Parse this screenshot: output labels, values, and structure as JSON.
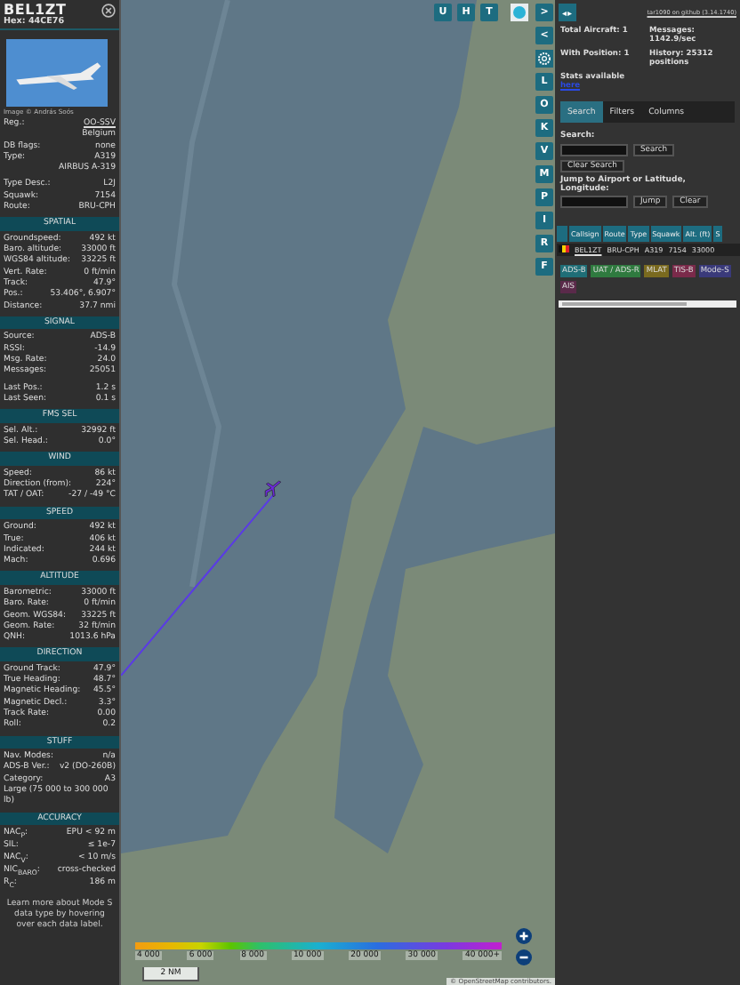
{
  "aircraft": {
    "callsign": "BEL1ZT",
    "hex_label": "Hex:",
    "hex": "44CE76",
    "photo_credit": "Image © András Soós",
    "info_groups": [
      [
        {
          "label": "Reg.:",
          "value": "OO-SSV",
          "link": true
        },
        {
          "value": "Belgium"
        },
        {
          "label": "DB flags:",
          "value": "none"
        },
        {
          "label": "Type:",
          "value": "A319"
        },
        {
          "value": "AIRBUS A-319"
        }
      ],
      [
        {
          "label": "Type Desc.:",
          "value": "L2J"
        },
        {
          "label": "Squawk:",
          "value": "7154"
        },
        {
          "label": "Route:",
          "value": "BRU-CPH"
        }
      ]
    ],
    "sections": [
      {
        "title": "SPATIAL",
        "groups": [
          [
            {
              "label": "Groundspeed:",
              "value": "492 kt"
            },
            {
              "label": "Baro. altitude:",
              "value": "33000 ft"
            },
            {
              "label": "WGS84 altitude:",
              "value": "33225 ft"
            },
            {
              "label": "Vert. Rate:",
              "value": "0 ft/min"
            },
            {
              "label": "Track:",
              "value": "47.9°"
            },
            {
              "label": "Pos.:",
              "value": "53.406°, 6.907°"
            },
            {
              "label": "Distance:",
              "value": "37.7 nmi"
            }
          ]
        ]
      },
      {
        "title": "SIGNAL",
        "groups": [
          [
            {
              "label": "Source:",
              "value": "ADS-B"
            },
            {
              "label": "RSSI:",
              "value": "-14.9"
            },
            {
              "label": "Msg. Rate:",
              "value": "24.0"
            },
            {
              "label": "Messages:",
              "value": "25051"
            }
          ],
          [
            {
              "label": "Last Pos.:",
              "value": "1.2 s"
            },
            {
              "label": "Last Seen:",
              "value": "0.1 s"
            }
          ]
        ]
      },
      {
        "title": "FMS SEL",
        "groups": [
          [
            {
              "label": "Sel. Alt.:",
              "value": "32992 ft"
            },
            {
              "label": "Sel. Head.:",
              "value": "0.0°"
            }
          ]
        ]
      },
      {
        "title": "WIND",
        "groups": [
          [
            {
              "label": "Speed:",
              "value": "86 kt"
            },
            {
              "label": "Direction (from):",
              "value": "224°"
            },
            {
              "label": "TAT / OAT:",
              "value": "-27 / -49 °C"
            }
          ]
        ]
      },
      {
        "title": "SPEED",
        "groups": [
          [
            {
              "label": "Ground:",
              "value": "492 kt"
            },
            {
              "label": "True:",
              "value": "406 kt"
            },
            {
              "label": "Indicated:",
              "value": "244 kt"
            },
            {
              "label": "Mach:",
              "value": "0.696"
            }
          ]
        ]
      },
      {
        "title": "ALTITUDE",
        "groups": [
          [
            {
              "label": "Barometric:",
              "value": "33000 ft"
            },
            {
              "label": "Baro. Rate:",
              "value": "0 ft/min"
            },
            {
              "label": "Geom. WGS84:",
              "value": "33225 ft"
            },
            {
              "label": "Geom. Rate:",
              "value": "32 ft/min"
            },
            {
              "label": "QNH:",
              "value": "1013.6 hPa"
            }
          ]
        ]
      },
      {
        "title": "DIRECTION",
        "groups": [
          [
            {
              "label": "Ground Track:",
              "value": "47.9°"
            },
            {
              "label": "True Heading:",
              "value": "48.7°"
            },
            {
              "label": "Magnetic Heading:",
              "value": "45.5°"
            },
            {
              "label": "Magnetic Decl.:",
              "value": "3.3°"
            },
            {
              "label": "Track Rate:",
              "value": "0.00"
            },
            {
              "label": "Roll:",
              "value": "0.2"
            }
          ]
        ]
      },
      {
        "title": "STUFF",
        "groups": [
          [
            {
              "label": "Nav. Modes:",
              "value": "n/a"
            },
            {
              "label": "ADS-B Ver.:",
              "value": "v2 (DO-260B)"
            },
            {
              "label": "Category:",
              "value": "A3"
            },
            {
              "label": "Large (75 000 to 300 000 lb)"
            }
          ]
        ]
      },
      {
        "title": "ACCURACY",
        "groups": [
          [
            {
              "label": "NAC$_{P}$:",
              "value": "EPU < 92 m"
            },
            {
              "label": "SIL:",
              "value": "≤ 1e-7"
            },
            {
              "label": "NAC$_{V}$:",
              "value": "< 10 m/s"
            },
            {
              "label": "NIC$_{BARO}$:",
              "value": "cross-checked"
            },
            {
              "label": "R$_{C}$:",
              "value": "186 m"
            }
          ]
        ]
      }
    ],
    "footer": "Learn more about Mode S data type by hovering over each data label."
  },
  "map": {
    "top_buttons": [
      "U",
      "H",
      "T"
    ],
    "side_buttons": [
      {
        "label": ">",
        "kind": "text"
      },
      {
        "label": "<",
        "kind": "text"
      },
      {
        "kind": "gear"
      },
      {
        "label": "L",
        "kind": "text"
      },
      {
        "label": "O",
        "kind": "text"
      },
      {
        "label": "K",
        "kind": "text"
      },
      {
        "label": "V",
        "kind": "text"
      },
      {
        "label": "M",
        "kind": "text"
      },
      {
        "label": "P",
        "kind": "text"
      },
      {
        "label": "I",
        "kind": "text"
      },
      {
        "label": "R",
        "kind": "text"
      },
      {
        "label": "F",
        "kind": "text"
      }
    ],
    "altitude_ticks": [
      "4 000",
      "6 000",
      "8 000",
      "10 000",
      "20 000",
      "30 000",
      "40 000+"
    ],
    "scale": "2 NM",
    "attribution": "© OpenStreetMap contributors."
  },
  "panel": {
    "toggle": "◂▸",
    "version_link": "tar1090 on github (3.14.1740)",
    "stats": [
      {
        "label": "Total Aircraft: 1"
      },
      {
        "label": "Messages:",
        "value": "1142.9/sec"
      },
      {
        "label": "With Position: 1"
      },
      {
        "label": "History: 25312 positions"
      }
    ],
    "stats_link_text": "Stats available",
    "stats_link": "here",
    "tabs": [
      {
        "label": "Search",
        "selected": true
      },
      {
        "label": "Filters",
        "selected": false
      },
      {
        "label": "Columns",
        "selected": false
      }
    ],
    "search_label": "Search:",
    "search_button": "Search",
    "clear_search": "Clear Search",
    "jump_label": "Jump to Airport or Latitude, Longitude:",
    "jump_button": "Jump",
    "clear_button": "Clear",
    "columns": [
      "Callsign",
      "Route",
      "Type",
      "Squawk",
      "Alt. (ft)",
      "S"
    ],
    "rows": [
      {
        "cells": [
          "BEL1ZT",
          "BRU-CPH",
          "A319",
          "7154",
          "33000"
        ]
      }
    ],
    "legend": [
      {
        "label": "ADS-B",
        "color": "#1f6e77"
      },
      {
        "label": "UAT / ADS-R",
        "color": "#2f7a3f"
      },
      {
        "label": "MLAT",
        "color": "#7a6a1f"
      },
      {
        "label": "TIS-B",
        "color": "#7a2a4a"
      },
      {
        "label": "Mode-S",
        "color": "#3a3a7a"
      },
      {
        "label": "AIS",
        "color": "#5a2a4a"
      }
    ]
  }
}
